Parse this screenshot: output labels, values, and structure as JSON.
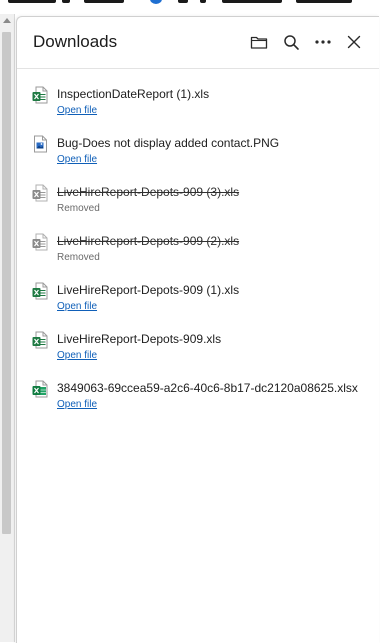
{
  "panel": {
    "title": "Downloads"
  },
  "header_actions": [
    {
      "name": "open-folder",
      "icon": "folder-icon"
    },
    {
      "name": "search",
      "icon": "search-icon"
    },
    {
      "name": "more-options",
      "icon": "more-icon"
    },
    {
      "name": "close",
      "icon": "close-icon"
    }
  ],
  "downloads": [
    {
      "filename": "InspectionDateReport (1).xls",
      "status": "available",
      "action": "Open file",
      "icon": "excel-xls-icon"
    },
    {
      "filename": "Bug-Does not display added contact.PNG",
      "status": "available",
      "action": "Open file",
      "icon": "image-file-icon"
    },
    {
      "filename": "LiveHireReport-Depots-909 (3).xls",
      "status": "removed",
      "action": "Removed",
      "icon": "excel-xls-icon"
    },
    {
      "filename": "LiveHireReport-Depots-909 (2).xls",
      "status": "removed",
      "action": "Removed",
      "icon": "excel-xls-icon"
    },
    {
      "filename": "LiveHireReport-Depots-909 (1).xls",
      "status": "available",
      "action": "Open file",
      "icon": "excel-xls-icon"
    },
    {
      "filename": "LiveHireReport-Depots-909.xls",
      "status": "available",
      "action": "Open file",
      "icon": "excel-xls-icon"
    },
    {
      "filename": "3849063-69ccea59-a2c6-40c6-8b17-dc2120a08625.xlsx",
      "status": "available",
      "action": "Open file",
      "icon": "excel-xlsx-icon"
    }
  ],
  "colors": {
    "link": "#0f5fb8",
    "excel_green": "#1f7a43",
    "removed_gray": "#8a8a8a"
  }
}
